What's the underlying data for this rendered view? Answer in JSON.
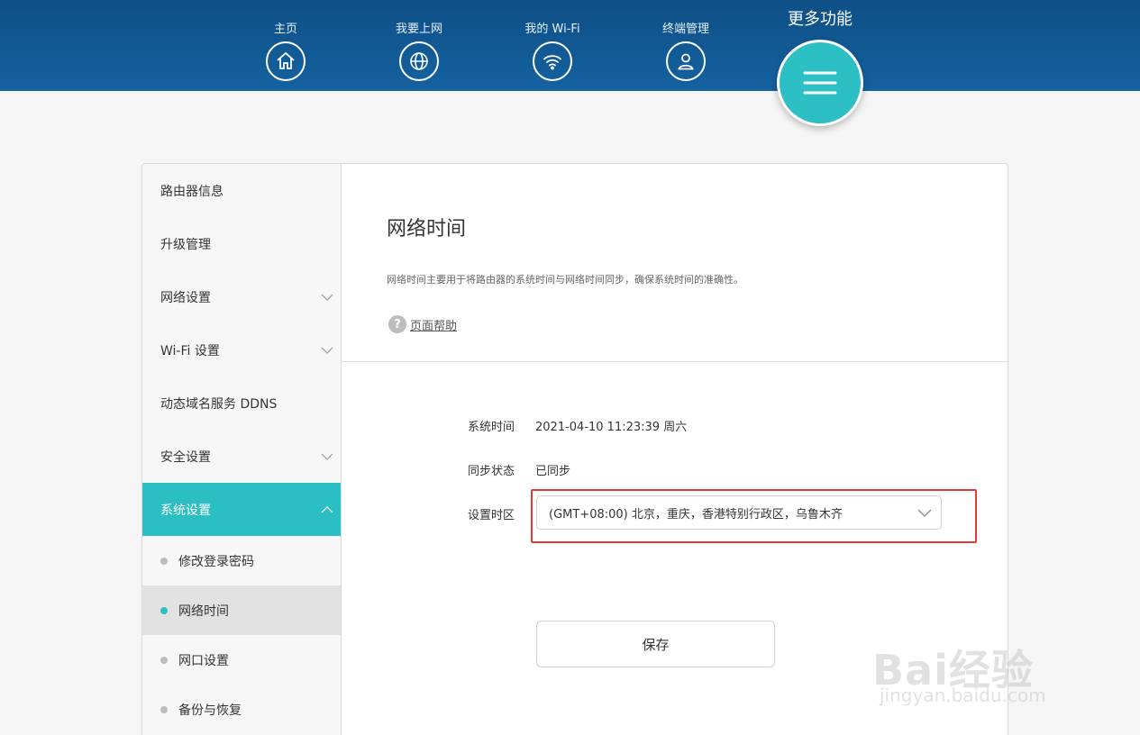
{
  "nav": {
    "items": [
      {
        "label": "主页",
        "icon": "home-icon"
      },
      {
        "label": "我要上网",
        "icon": "globe-icon"
      },
      {
        "label": "我的 Wi-Fi",
        "icon": "wifi-icon"
      },
      {
        "label": "终端管理",
        "icon": "user-icon"
      }
    ],
    "more_label": "更多功能",
    "more_icon": "menu-icon"
  },
  "sidebar": {
    "items": [
      {
        "label": "路由器信息"
      },
      {
        "label": "升级管理"
      },
      {
        "label": "网络设置"
      },
      {
        "label": "Wi-Fi 设置"
      },
      {
        "label": "动态域名服务 DDNS"
      },
      {
        "label": "安全设置"
      },
      {
        "label": "系统设置"
      }
    ],
    "sub_items": [
      {
        "label": "修改登录密码"
      },
      {
        "label": "网络时间"
      },
      {
        "label": "网口设置"
      },
      {
        "label": "备份与恢复"
      }
    ]
  },
  "content": {
    "title": "网络时间",
    "description": "网络时间主要用于将路由器的系统时间与网络时间同步，确保系统时间的准确性。",
    "help": "页面帮助",
    "system_time_label": "系统时间",
    "system_time_value": "2021-04-10 11:23:39 周六",
    "sync_label": "同步状态",
    "sync_value": "已同步",
    "timezone_label": "设置时区",
    "timezone_value": "(GMT+08:00) 北京，重庆，香港特别行政区，乌鲁木齐",
    "save": "保存"
  },
  "watermark": {
    "brand": "Bai经验",
    "url": "jingyan.baidu.com"
  },
  "colors": {
    "header": "#1462a0",
    "accent": "#2bbfc3",
    "highlight": "#e53935"
  }
}
